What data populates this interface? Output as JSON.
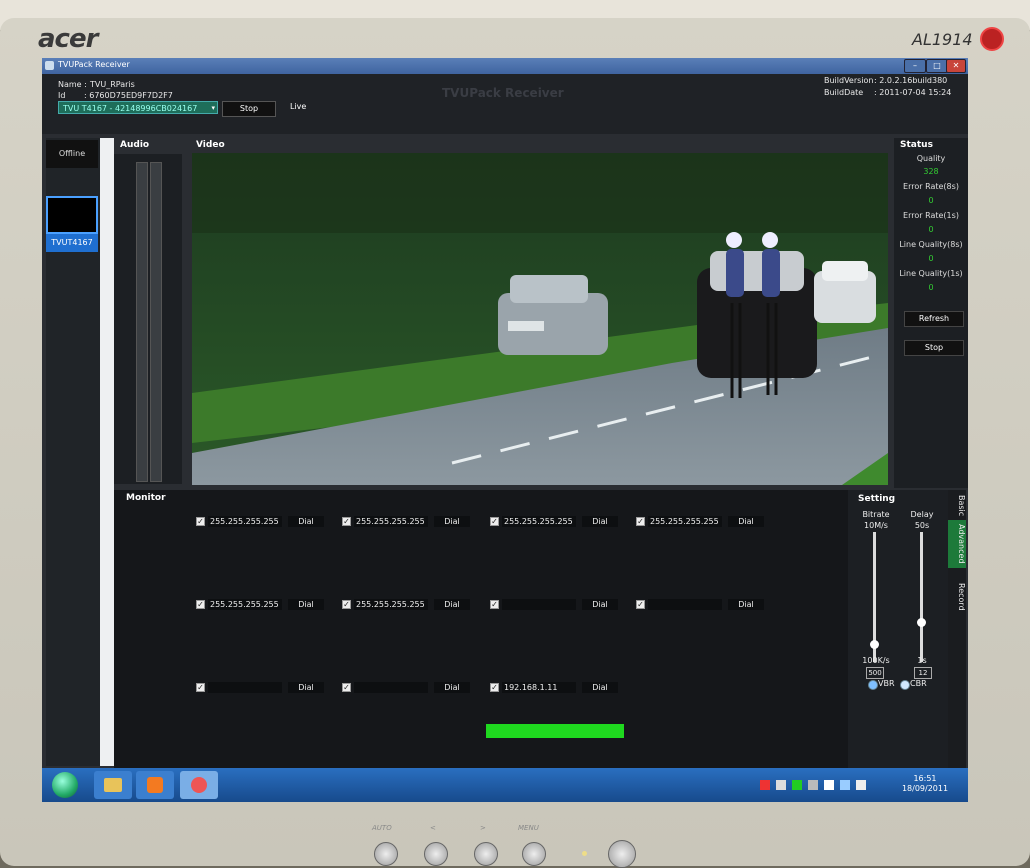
{
  "monitor_bezel": {
    "brand": "acer",
    "model": "AL1914",
    "front_labels": [
      "AUTO",
      "<",
      ">",
      "MENU"
    ]
  },
  "window": {
    "title": "TVUPack Receiver",
    "app_title": "TVUPack Receiver",
    "name_label": "Name :",
    "name_value": "TVU_RParis",
    "id_label": "Id",
    "id_value": ": 6760D75ED9F7D2F7",
    "build_version_label": "BuildVersion",
    "build_version_value": ": 2.0.2.16build380",
    "build_date_label": "BuildDate",
    "build_date_value": ": 2011-07-04 15:24",
    "device_select": "TVU T4167 - 42148996CB024167",
    "stop_label": "Stop",
    "live_label": "Live"
  },
  "left_panel": {
    "offline_label": "Offline",
    "device_label": "TVUT4167"
  },
  "panels": {
    "audio": "Audio",
    "video": "Video",
    "status": "Status",
    "monitor": "Monitor",
    "setting": "Setting"
  },
  "status": {
    "quality_label": "Quality",
    "quality_value": "328",
    "error_rate_8s_label": "Error Rate(8s)",
    "error_rate_8s_value": "0",
    "error_rate_1s_label": "Error Rate(1s)",
    "error_rate_1s_value": "0",
    "line_quality_8s_label": "Line Quality(8s)",
    "line_quality_8s_value": "0",
    "line_quality_1s_label": "Line Quality(1s)",
    "line_quality_1s_value": "0",
    "refresh_label": "Refresh",
    "stop_label": "Stop"
  },
  "monitor": {
    "dial_label": "Dial",
    "rows": [
      {
        "cells": [
          {
            "ip": "255.255.255.255"
          },
          {
            "ip": "255.255.255.255"
          },
          {
            "ip": "255.255.255.255"
          },
          {
            "ip": "255.255.255.255"
          }
        ]
      },
      {
        "cells": [
          {
            "ip": "255.255.255.255"
          },
          {
            "ip": "255.255.255.255"
          },
          {
            "ip": ""
          },
          {
            "ip": ""
          }
        ]
      },
      {
        "cells": [
          {
            "ip": ""
          },
          {
            "ip": ""
          },
          {
            "ip": "192.168.1.11"
          }
        ]
      }
    ]
  },
  "setting": {
    "bitrate_label": "Bitrate",
    "bitrate_max": "10M/s",
    "bitrate_min": "100K/s",
    "bitrate_value": "500",
    "delay_label": "Delay",
    "delay_max": "50s",
    "delay_min": "1s",
    "delay_value": "12",
    "vbr_label": "VBR",
    "cbr_label": "CBR",
    "tabs": [
      "Basic",
      "Advanced",
      "Record"
    ]
  },
  "taskbar": {
    "time": "16:51",
    "date": "18/09/2011"
  },
  "colors": {
    "accent_blue": "#1f6fd0",
    "status_green": "#33cc33",
    "bar_green": "#1fd91f"
  }
}
